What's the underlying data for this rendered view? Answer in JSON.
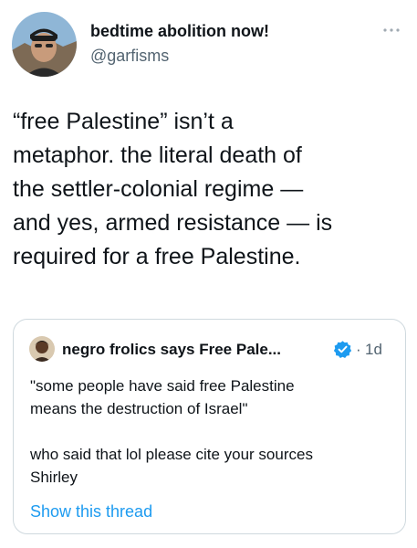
{
  "tweet": {
    "author": {
      "display_name": "bedtime abolition now!",
      "handle": "@garfisms",
      "avatar_icon": "profile-photo"
    },
    "more_icon": "ellipsis-icon",
    "text": "“free Palestine” isn’t a\nmetaphor. the literal death of\nthe settler-colonial regime —\nand yes, armed resistance — is\nrequired for a free Palestine."
  },
  "quote": {
    "author": {
      "display_name": "negro frolics says Free Pale...",
      "verified_icon": "verified-badge-icon",
      "separator": "·",
      "time": "1d"
    },
    "text": "\"some people have said free Palestine\nmeans the destruction of Israel\"\n\nwho said that lol please cite your sources\nShirley",
    "show_thread_label": "Show this thread"
  },
  "colors": {
    "link": "#1d9bf0",
    "secondary_text": "#536471",
    "border": "#cfd9de"
  }
}
